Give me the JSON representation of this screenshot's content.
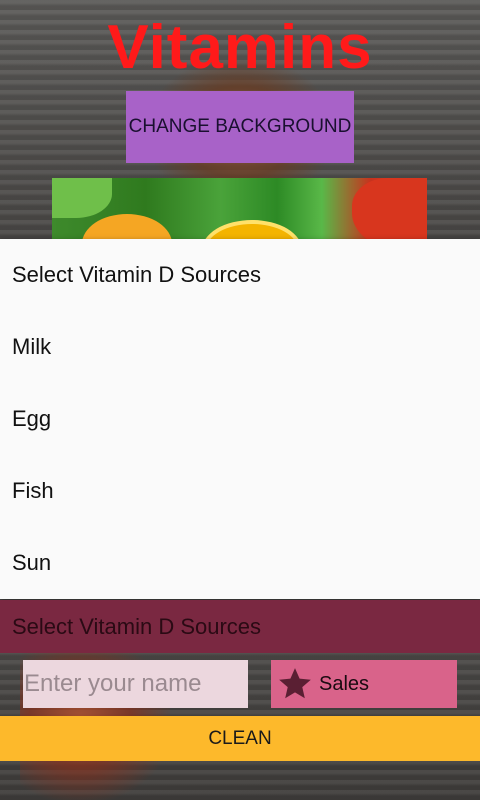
{
  "header": {
    "title": "Vitamins",
    "change_background_label": "CHANGE BACKGROUND"
  },
  "colors": {
    "title": "#ff1a1a",
    "change_background_button": "#a862c8",
    "spinner_bar": "#7a2841",
    "sales_box": "#d9638a",
    "clean_button": "#fdb92b"
  },
  "dropdown": {
    "items": [
      {
        "label": "Select Vitamin D Sources"
      },
      {
        "label": "Milk"
      },
      {
        "label": "Egg"
      },
      {
        "label": "Fish"
      },
      {
        "label": "Sun"
      }
    ]
  },
  "spinner": {
    "selected": "Select Vitamin D Sources"
  },
  "name_input": {
    "placeholder": "Enter your name",
    "value": ""
  },
  "sales": {
    "label": "Sales",
    "icon": "star-icon"
  },
  "actions": {
    "clean_label": "CLEAN"
  }
}
